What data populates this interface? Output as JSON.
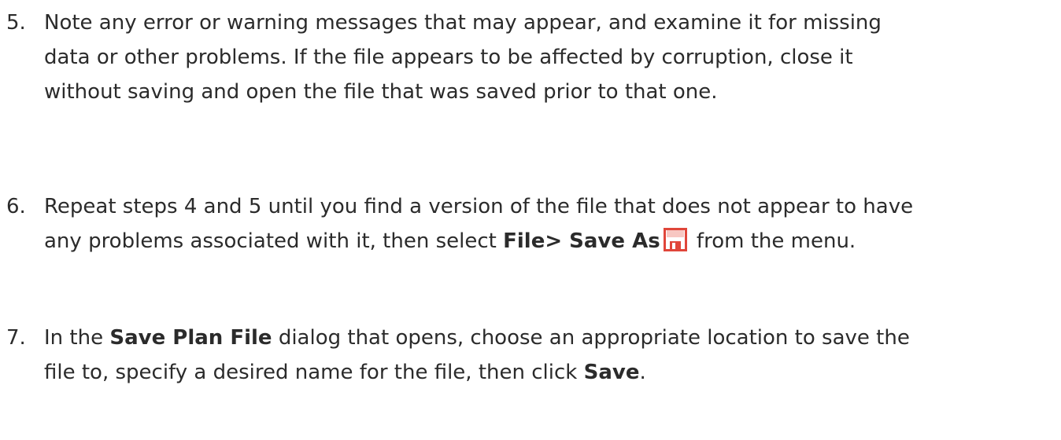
{
  "steps": [
    {
      "number": "5.",
      "lines": [
        "Note any error or warning messages that may appear, and examine it for missing",
        "data or other problems. If the file appears to be affected by corruption, close it",
        "without saving and open the file that was saved prior to that one."
      ]
    },
    {
      "number": "6.",
      "line1": "Repeat steps 4 and 5 until you find a version of the file that does not appear to have",
      "line2_prefix": "any problems associated with it, then select ",
      "line2_bold": "File> Save As",
      "line2_suffix": " from the menu.",
      "icon": "save-as-icon",
      "icon_colors": {
        "accent": "#e0463a",
        "light": "#f7c7c2"
      }
    },
    {
      "number": "7.",
      "line1_prefix": "In the ",
      "line1_bold": "Save Plan File",
      "line1_suffix": " dialog that opens, choose an appropriate location to save the",
      "line2_prefix": "file to, specify a desired name for the file, then click ",
      "line2_bold": "Save",
      "line2_suffix": "."
    }
  ]
}
